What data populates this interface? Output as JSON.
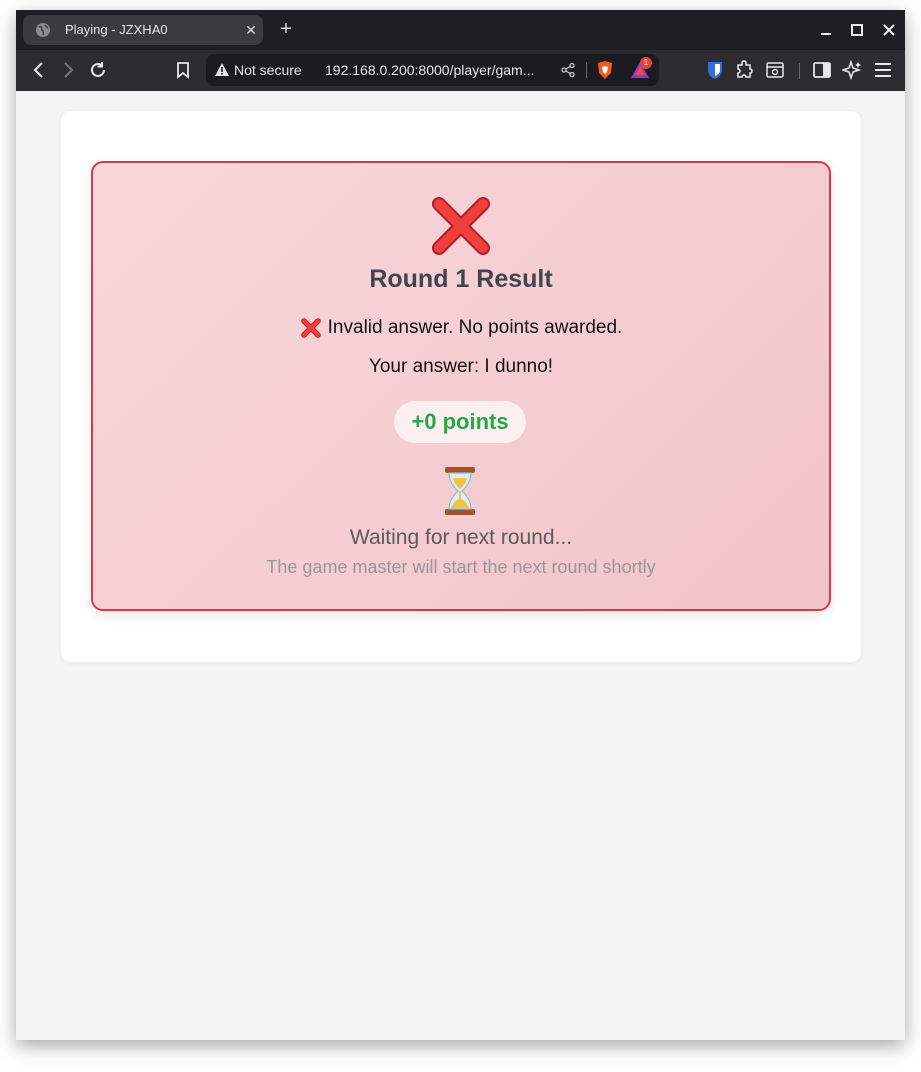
{
  "browser": {
    "tab_title": "Playing - JZXHA0",
    "url_security": "Not secure",
    "url": "192.168.0.200:8000/player/gam...",
    "rewards_badge": "1"
  },
  "result": {
    "status": "incorrect",
    "title": "Round 1 Result",
    "message": "Invalid answer. No points awarded.",
    "answer_prefix": "Your answer:",
    "answer_value": "I dunno!",
    "points": "+0 points",
    "waiting_title": "Waiting for next round...",
    "waiting_subtitle": "The game master will start the next round shortly"
  },
  "colors": {
    "result_border": "#d63b48",
    "result_bg": "#f8d7da",
    "points_text": "#28a745",
    "title_text": "#3f4650"
  },
  "icons": {
    "result_icon": "cross-mark-icon",
    "waiting_icon": "hourglass-icon"
  }
}
